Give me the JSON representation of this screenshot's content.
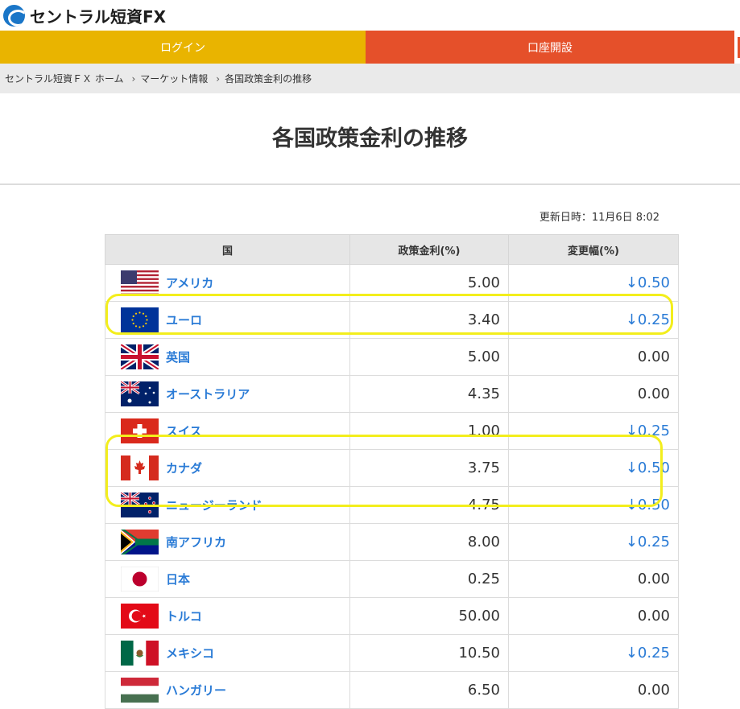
{
  "header": {
    "logo_text": "セントラル短資FX"
  },
  "nav": {
    "login_label": "ログイン",
    "open_account_label": "口座開設"
  },
  "breadcrumb": [
    "セントラル短資ＦＸ ホーム",
    "マーケット情報",
    "各国政策金利の推移"
  ],
  "page": {
    "title": "各国政策金利の推移",
    "updated": "更新日時：11月6日 8:02"
  },
  "table": {
    "headers": [
      "国",
      "政策金利(%)",
      "変更幅(%)"
    ],
    "rows": [
      {
        "flag": "usa-flag-icon",
        "country": "アメリカ",
        "rate": "5.00",
        "change": "↓0.50",
        "down": true
      },
      {
        "flag": "eu-flag-icon",
        "country": "ユーロ",
        "rate": "3.40",
        "change": "↓0.25",
        "down": true
      },
      {
        "flag": "uk-flag-icon",
        "country": "英国",
        "rate": "5.00",
        "change": "0.00",
        "down": false
      },
      {
        "flag": "australia-flag-icon",
        "country": "オーストラリア",
        "rate": "4.35",
        "change": "0.00",
        "down": false
      },
      {
        "flag": "switzerland-flag-icon",
        "country": "スイス",
        "rate": "1.00",
        "change": "↓0.25",
        "down": true
      },
      {
        "flag": "canada-flag-icon",
        "country": "カナダ",
        "rate": "3.75",
        "change": "↓0.50",
        "down": true
      },
      {
        "flag": "new-zealand-flag-icon",
        "country": "ニュージーランド",
        "rate": "4.75",
        "change": "↓0.50",
        "down": true
      },
      {
        "flag": "south-africa-flag-icon",
        "country": "南アフリカ",
        "rate": "8.00",
        "change": "↓0.25",
        "down": true
      },
      {
        "flag": "japan-flag-icon",
        "country": "日本",
        "rate": "0.25",
        "change": "0.00",
        "down": false
      },
      {
        "flag": "turkey-flag-icon",
        "country": "トルコ",
        "rate": "50.00",
        "change": "0.00",
        "down": false
      },
      {
        "flag": "mexico-flag-icon",
        "country": "メキシコ",
        "rate": "10.50",
        "change": "↓0.25",
        "down": true
      },
      {
        "flag": "hungary-flag-icon",
        "country": "ハンガリー",
        "rate": "6.50",
        "change": "0.00",
        "down": false
      }
    ]
  },
  "colors": {
    "login": "#e9b400",
    "open_account": "#e5502a",
    "link": "#2a7bd6",
    "highlight": "#f3ee1c"
  }
}
